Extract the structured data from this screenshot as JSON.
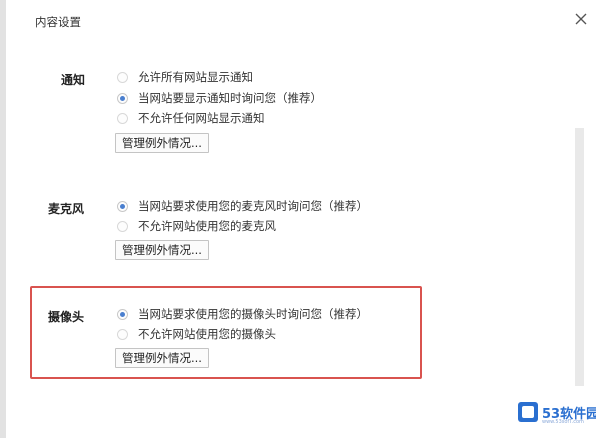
{
  "dialog": {
    "title": "内容设置",
    "close_icon": "close-icon"
  },
  "sections": {
    "notifications": {
      "label": "通知",
      "options": [
        {
          "label": "允许所有网站显示通知",
          "checked": false
        },
        {
          "label": "当网站要显示通知时询问您（推荐）",
          "checked": true
        },
        {
          "label": "不允许任何网站显示通知",
          "checked": false
        }
      ],
      "manage_button": "管理例外情况..."
    },
    "microphone": {
      "label": "麦克风",
      "options": [
        {
          "label": "当网站要求使用您的麦克风时询问您（推荐）",
          "checked": true
        },
        {
          "label": "不允许网站使用您的麦克风",
          "checked": false
        }
      ],
      "manage_button": "管理例外情况..."
    },
    "camera": {
      "label": "摄像头",
      "options": [
        {
          "label": "当网站要求使用您的摄像头时询问您（推荐）",
          "checked": true
        },
        {
          "label": "不允许网站使用您的摄像头",
          "checked": false
        }
      ],
      "manage_button": "管理例外情况..."
    }
  },
  "highlight_color": "#d9534f",
  "accent_color": "#4a7fcf",
  "watermark": {
    "text": "53软件园",
    "sub": "www.53sofT.com"
  }
}
